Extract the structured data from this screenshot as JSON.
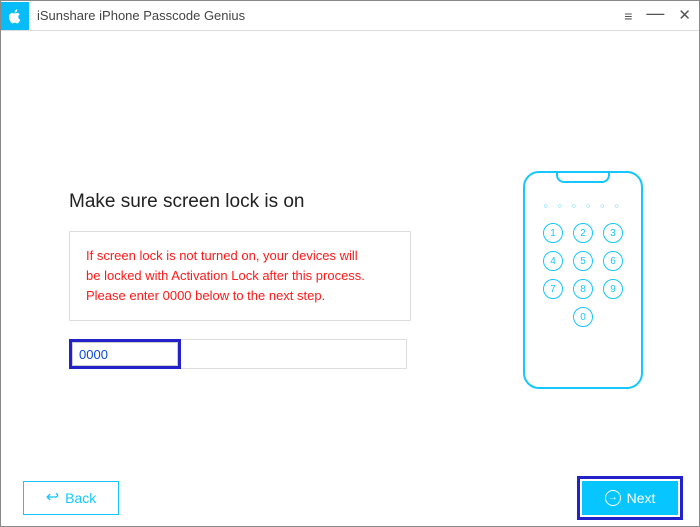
{
  "window": {
    "title": "iSunshare iPhone Passcode Genius"
  },
  "main": {
    "heading": "Make sure screen lock is on",
    "warning_l1": "If screen lock is not turned on, your devices will",
    "warning_l2": "be locked with Activation Lock after this process.",
    "warning_l3": "Please enter 0000 below to the next step.",
    "input_value": "0000"
  },
  "keypad": {
    "k1": "1",
    "k2": "2",
    "k3": "3",
    "k4": "4",
    "k5": "5",
    "k6": "6",
    "k7": "7",
    "k8": "8",
    "k9": "9",
    "k0": "0",
    "dots": "○ ○ ○ ○ ○ ○"
  },
  "footer": {
    "back_label": "Back",
    "next_label": "Next"
  }
}
